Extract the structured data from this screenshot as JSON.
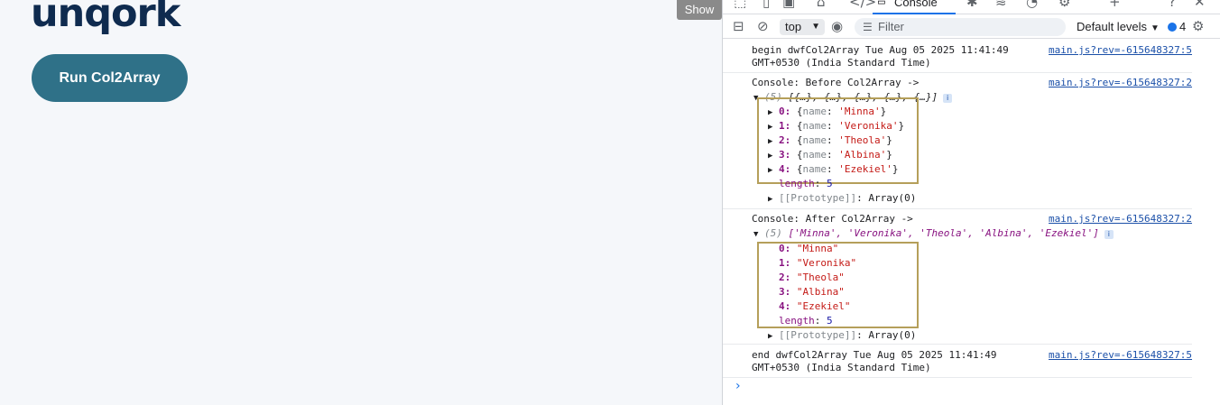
{
  "app": {
    "logo": "unqork",
    "run_button": "Run Col2Array",
    "show_button": "Show"
  },
  "devtools": {
    "tabs": {
      "console": "Console"
    },
    "toolbar": {
      "context": "top",
      "filter_placeholder": "Filter",
      "levels": "Default levels",
      "issues_count": "4"
    },
    "console": {
      "begin": {
        "line1": "begin dwfCol2Array Tue Aug 05 2025 11:41:49",
        "line2": "GMT+0530 (India Standard Time)",
        "source": "main.js?rev=-615648327:5"
      },
      "before": {
        "label": "Console: Before Col2Array ->",
        "source": "main.js?rev=-615648327:2",
        "summary_count": "(5)",
        "summary": "[{…}, {…}, {…}, {…}, {…}]",
        "items": [
          {
            "index": "0",
            "key": "name",
            "value": "'Minna'"
          },
          {
            "index": "1",
            "key": "name",
            "value": "'Veronika'"
          },
          {
            "index": "2",
            "key": "name",
            "value": "'Theola'"
          },
          {
            "index": "3",
            "key": "name",
            "value": "'Albina'"
          },
          {
            "index": "4",
            "key": "name",
            "value": "'Ezekiel'"
          }
        ],
        "length_key": "length",
        "length_value": "5",
        "prototype": "[[Prototype]]",
        "prototype_value": "Array(0)"
      },
      "after": {
        "label": "Console: After Col2Array ->",
        "source": "main.js?rev=-615648327:2",
        "summary_count": "(5)",
        "summary": "['Minna', 'Veronika', 'Theola', 'Albina', 'Ezekiel']",
        "items": [
          {
            "index": "0",
            "value": "\"Minna\""
          },
          {
            "index": "1",
            "value": "\"Veronika\""
          },
          {
            "index": "2",
            "value": "\"Theola\""
          },
          {
            "index": "3",
            "value": "\"Albina\""
          },
          {
            "index": "4",
            "value": "\"Ezekiel\""
          }
        ],
        "length_key": "length",
        "length_value": "5",
        "prototype": "[[Prototype]]",
        "prototype_value": "Array(0)"
      },
      "end": {
        "line1": "end dwfCol2Array Tue Aug 05 2025 11:41:49",
        "line2": "GMT+0530 (India Standard Time)",
        "source": "main.js?rev=-615648327:5"
      }
    }
  }
}
